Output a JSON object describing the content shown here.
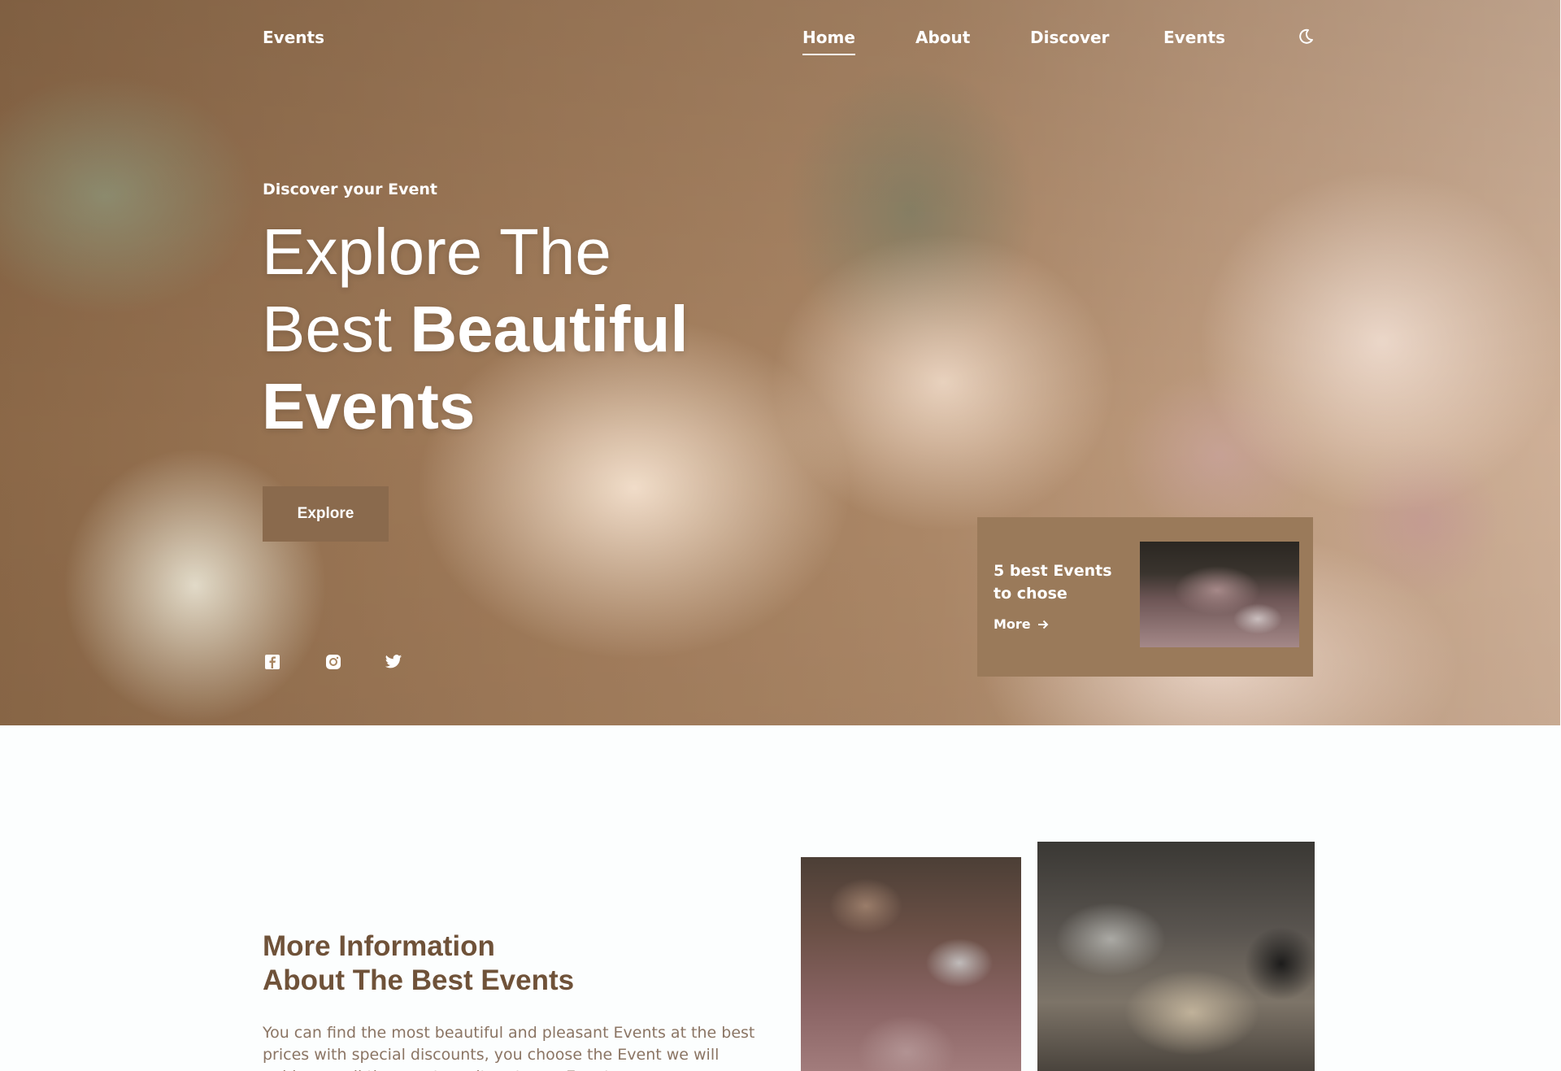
{
  "header": {
    "brand": "Events",
    "nav": [
      "Home",
      "About",
      "Discover",
      "Events"
    ],
    "active_nav": "Home",
    "theme_icon": "moon-icon"
  },
  "hero": {
    "eyebrow": "Discover your Event",
    "title_line1": "Explore The",
    "title_line2_light": "Best ",
    "title_line2_bold": "Beautiful",
    "title_line3_bold": "Events",
    "cta_label": "Explore",
    "social_icons": [
      "facebook-icon",
      "instagram-icon",
      "twitter-icon"
    ],
    "background": "floral-arrangement-photo"
  },
  "card": {
    "title": "5 best Events to chose",
    "more_label": "More",
    "more_icon": "arrow-right-icon"
  },
  "info": {
    "title_line1": "More Information",
    "title_line2": "About The Best Events",
    "text": "You can find the most beautiful and pleasant Events at the best prices with special discounts, you choose the Event we will guide you all the way to wait, get your Event now."
  },
  "colors": {
    "accent": "#8a6a4d",
    "card": "#9a7a5a",
    "heading": "#6f5239",
    "body_text": "#8b7564",
    "page_bg": "#fcfefe"
  }
}
